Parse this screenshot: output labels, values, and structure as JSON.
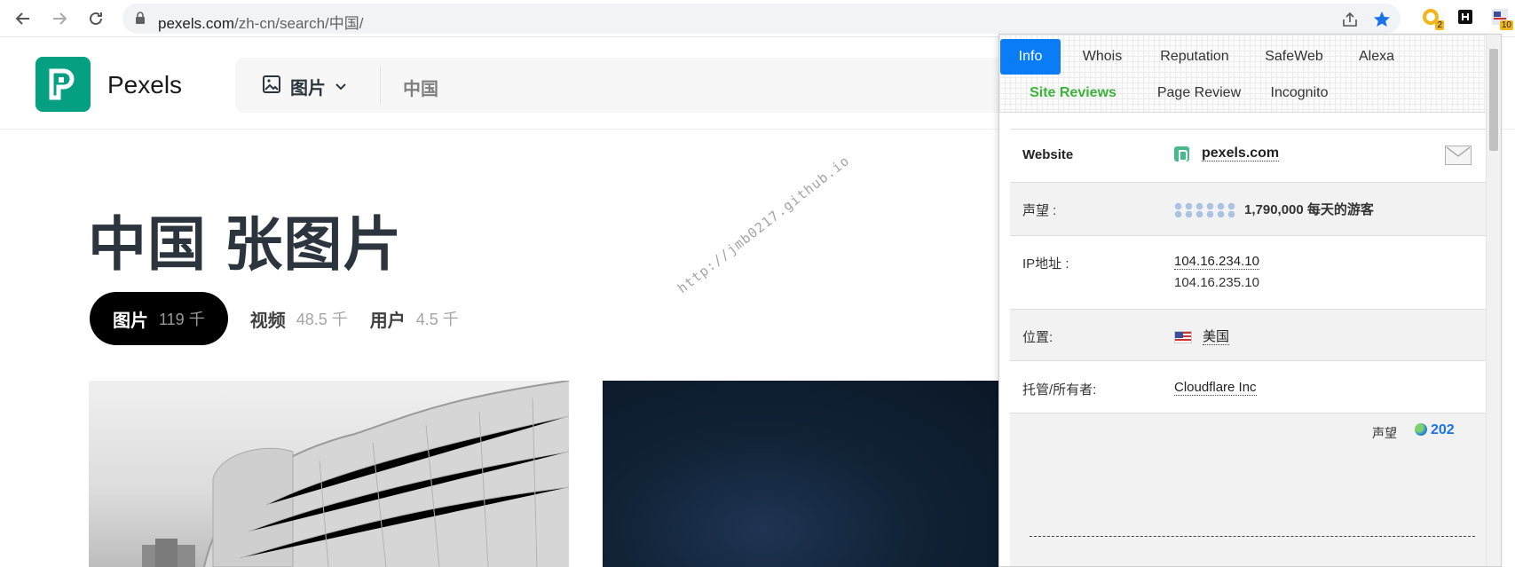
{
  "browser": {
    "url_domain": "pexels.com",
    "url_path": "/zh-cn/search/中国/",
    "ext_badge_1": "2",
    "ext_badge_3": "10"
  },
  "pexels": {
    "brand": "Pexels",
    "search_type": "图片",
    "search_query": "中国",
    "page_title": "中国 张图片",
    "tabs": [
      {
        "label": "图片",
        "count": "119 千"
      },
      {
        "label": "视频",
        "count": "48.5 千"
      },
      {
        "label": "用户",
        "count": "4.5 千"
      }
    ],
    "watermark": "http://jmb0217.github.io"
  },
  "popup": {
    "tabs_row1": [
      "Info",
      "Whois",
      "Reputation",
      "SafeWeb",
      "Alexa"
    ],
    "tabs_row2": [
      "Site Reviews",
      "Page Review",
      "Incognito"
    ],
    "website_label": "Website",
    "website_value": "pexels.com",
    "reputation_label": "声望 :",
    "reputation_value": "1,790,000 每天的游客",
    "ip_label": "IP地址 :",
    "ip_values": [
      "104.16.234.10",
      "104.16.235.10"
    ],
    "location_label": "位置:",
    "location_value": "美国",
    "host_label": "托管/所有者:",
    "host_value": "Cloudflare Inc",
    "rank_label": "声望",
    "rank_value": "202"
  }
}
